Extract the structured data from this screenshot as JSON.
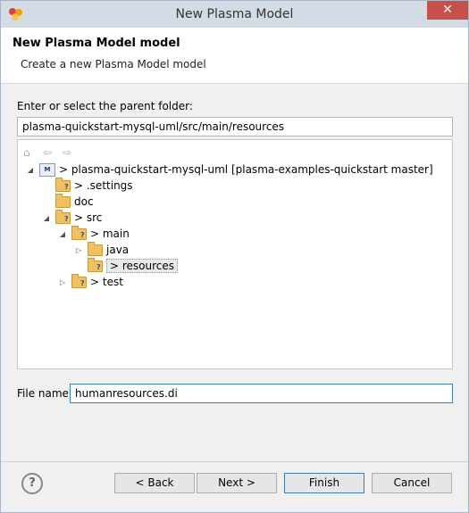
{
  "window": {
    "title": "New Plasma Model",
    "close_glyph": "✕"
  },
  "banner": {
    "title": "New Plasma Model model",
    "description": "Create a new Plasma Model model"
  },
  "parent": {
    "label": "Enter or select the parent folder:",
    "value": "plasma-quickstart-mysql-uml/src/main/resources"
  },
  "tree": {
    "toolbar": {
      "home_icon": "home-icon",
      "back_icon": "back-arrow-icon",
      "forward_icon": "forward-arrow-icon"
    },
    "rows": [
      {
        "label": "> plasma-quickstart-mysql-uml  [plasma-examples-quickstart master]",
        "expanded": true
      },
      {
        "label": "> .settings"
      },
      {
        "label": "doc"
      },
      {
        "label": "> src",
        "expanded": true
      },
      {
        "label": "> main",
        "expanded": true
      },
      {
        "label": "java",
        "collapsed": true
      },
      {
        "label": "> resources",
        "selected": true
      },
      {
        "label": "> test",
        "collapsed": true
      }
    ]
  },
  "file": {
    "label": "File name:",
    "value": "humanresources.di"
  },
  "buttons": {
    "back": "< Back",
    "next": "Next >",
    "finish": "Finish",
    "cancel": "Cancel",
    "help": "?"
  },
  "colors": {
    "titlebar": "#d3dbe4",
    "close": "#c7504a",
    "folder": "#f1c15f",
    "selection": "#e8e8e8"
  }
}
